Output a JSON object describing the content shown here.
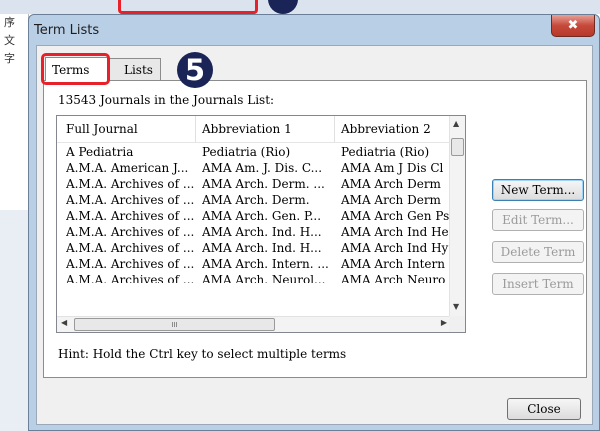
{
  "background": {
    "left_glyphs": [
      "序",
      "文",
      "字"
    ]
  },
  "dialog": {
    "title": "Term Lists",
    "close_glyph": "✖"
  },
  "tabs": [
    {
      "label": "Terms",
      "selected": true
    },
    {
      "label": "Lists",
      "selected": false
    }
  ],
  "annotation": {
    "step_number": "5"
  },
  "count_text": "13543 Journals in the Journals List:",
  "table": {
    "headers": [
      "Full Journal",
      "Abbreviation 1",
      "Abbreviation 2"
    ],
    "rows": [
      [
        "A Pediatria",
        "Pediatria (Rio)",
        "Pediatria (Rio)"
      ],
      [
        "A.M.A. American J...",
        "AMA Am. J. Dis. C...",
        "AMA Am J Dis Cl"
      ],
      [
        "A.M.A. Archives of ...",
        "AMA Arch. Derm. ...",
        "AMA Arch Derm"
      ],
      [
        "A.M.A. Archives of ...",
        "AMA Arch. Derm.",
        "AMA Arch Derm"
      ],
      [
        "A.M.A. Archives of ...",
        "AMA Arch. Gen. P...",
        "AMA Arch Gen Ps"
      ],
      [
        "A.M.A. Archives of ...",
        "AMA Arch. Ind. H...",
        "AMA Arch Ind He"
      ],
      [
        "A.M.A. Archives of ...",
        "AMA Arch. Ind. H...",
        "AMA Arch Ind Hy"
      ],
      [
        "A.M.A. Archives of ...",
        "AMA Arch. Intern. ...",
        "AMA Arch Intern"
      ],
      [
        "A.M.A. Archives of ...",
        "AMA Arch. Neurol...",
        "AMA Arch Neuro"
      ]
    ],
    "scroll_up_glyph": "▲",
    "scroll_down_glyph": "▼",
    "scroll_left_glyph": "◀",
    "scroll_right_glyph": "▶",
    "thumb_grip": "III"
  },
  "buttons": {
    "new_term": "New Term...",
    "edit_term": "Edit Term...",
    "delete_term": "Delete Term",
    "insert_term": "Insert Term",
    "close": "Close"
  },
  "hint": "Hint: Hold the Ctrl key to select multiple terms",
  "colors": {
    "annotation_red": "#e8202a",
    "annotation_navy": "#1a2457",
    "title_bar": "#b9cfe6",
    "close_button": "#c64a3b"
  }
}
